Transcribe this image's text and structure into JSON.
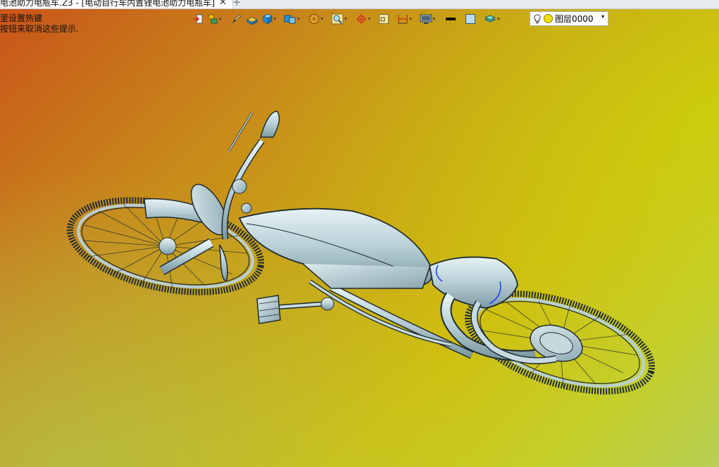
{
  "window": {
    "tab_title": "电池助力电瓶车.Z3 - [电动自行车内置锂电池助力电瓶车]",
    "tab_close_glyph": "✕",
    "tab_add_glyph": "+"
  },
  "hint": {
    "line1": "里设置热键",
    "line2": "按钮来取消这些提示."
  },
  "toolbar": {
    "buttons": [
      {
        "name": "exit-icon",
        "dropdown": false
      },
      {
        "name": "history-icon",
        "dropdown": true
      },
      {
        "name": "pencil-icon",
        "dropdown": false
      },
      {
        "name": "solid-box-icon",
        "dropdown": false
      },
      {
        "name": "cube-icon",
        "dropdown": true
      },
      {
        "name": "view-cube-icon",
        "dropdown": true
      },
      {
        "name": "render-sphere-icon",
        "dropdown": true
      },
      {
        "name": "zoom-fit-icon",
        "dropdown": true
      },
      {
        "name": "pivot-icon",
        "dropdown": true
      },
      {
        "name": "frame-icon",
        "dropdown": false
      },
      {
        "name": "dimension-icon",
        "dropdown": true
      },
      {
        "name": "display-icon",
        "dropdown": true
      },
      {
        "name": "line-color-icon",
        "dropdown": false
      },
      {
        "name": "fill-color-icon",
        "dropdown": false
      },
      {
        "name": "layers-icon",
        "dropdown": true
      }
    ],
    "dropdown_glyph": "▾"
  },
  "layer_select": {
    "value": "图层0000",
    "arrow_glyph": "▾",
    "dot_color": "#f1e000"
  },
  "colors": {
    "model_metal": "#b7cfd6",
    "model_outline": "#1f2a2e",
    "accent_blue": "#1a3cff"
  }
}
